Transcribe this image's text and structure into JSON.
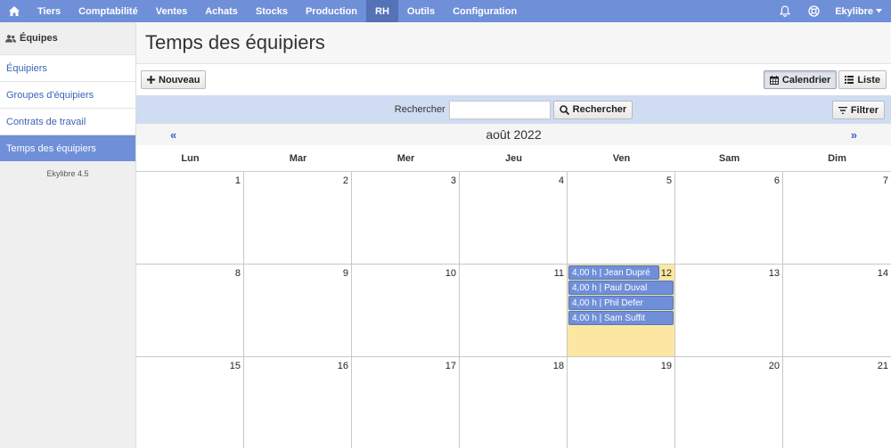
{
  "nav": {
    "home_icon": "home-icon",
    "items": [
      {
        "label": "Tiers",
        "active": false
      },
      {
        "label": "Comptabilité",
        "active": false
      },
      {
        "label": "Ventes",
        "active": false
      },
      {
        "label": "Achats",
        "active": false
      },
      {
        "label": "Stocks",
        "active": false
      },
      {
        "label": "Production",
        "active": false
      },
      {
        "label": "RH",
        "active": true
      },
      {
        "label": "Outils",
        "active": false
      },
      {
        "label": "Configuration",
        "active": false
      }
    ],
    "bell_icon": "bell-icon",
    "help_icon": "lifebuoy-icon",
    "user_label": "Ekylibre"
  },
  "sidebar": {
    "section_title": "Équipes",
    "items": [
      {
        "label": "Équipiers"
      },
      {
        "label": "Groupes d'équipiers"
      },
      {
        "label": "Contrats de travail"
      },
      {
        "label": "Temps des équipiers"
      }
    ],
    "version": "Ekylibre 4.5"
  },
  "page": {
    "title": "Temps des équipiers",
    "new_button": "Nouveau",
    "view_calendar": "Calendrier",
    "view_list": "Liste",
    "search_label": "Rechercher",
    "search_value": "",
    "search_button": "Rechercher",
    "filter_button": "Filtrer"
  },
  "calendar": {
    "month_label": "août 2022",
    "prev": "«",
    "next": "»",
    "weekdays": [
      "Lun",
      "Mar",
      "Mer",
      "Jeu",
      "Ven",
      "Sam",
      "Dim"
    ],
    "days": [
      {
        "n": "1"
      },
      {
        "n": "2"
      },
      {
        "n": "3"
      },
      {
        "n": "4"
      },
      {
        "n": "5"
      },
      {
        "n": "6"
      },
      {
        "n": "7"
      },
      {
        "n": "8"
      },
      {
        "n": "9"
      },
      {
        "n": "10"
      },
      {
        "n": "11"
      },
      {
        "n": "12",
        "today": true
      },
      {
        "n": "13"
      },
      {
        "n": "14"
      },
      {
        "n": "15"
      },
      {
        "n": "16"
      },
      {
        "n": "17"
      },
      {
        "n": "18"
      },
      {
        "n": "19"
      },
      {
        "n": "20"
      },
      {
        "n": "21"
      }
    ],
    "events_day_12": [
      "4,00 h | Jean Dupré",
      "4,00 h | Paul Duval",
      "4,00 h | Phil Defer",
      "4,00 h | Sam Suffit"
    ]
  },
  "colors": {
    "primary": "#6f8fd8",
    "primary_dark": "#5572b6",
    "search_band": "#cfdcf2",
    "today": "#fbe7a1"
  }
}
